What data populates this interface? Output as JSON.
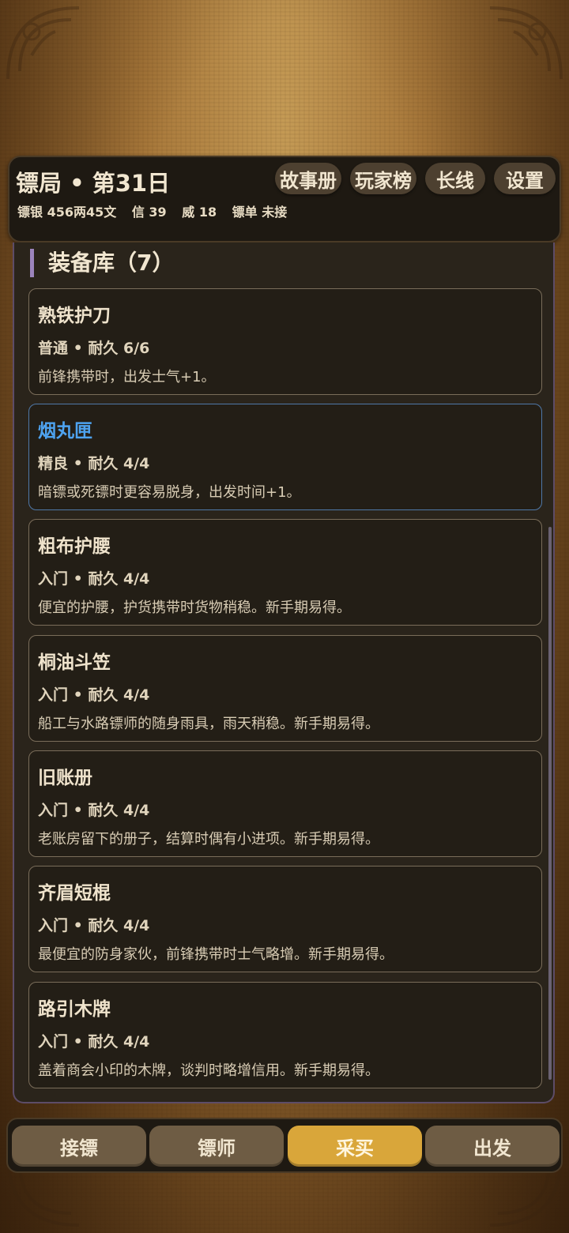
{
  "header": {
    "title": "镖局 • 第31日",
    "stats": {
      "silver": "镖银 456两45文",
      "trust": "信 39",
      "prestige": "威 18",
      "order": "镖单 未接"
    },
    "buttons": {
      "story": "故事册",
      "ranking": "玩家榜",
      "longline": "长线",
      "settings": "设置"
    }
  },
  "panel": {
    "title": "装备库（7）",
    "items": [
      {
        "name": "熟铁护刀",
        "meta": "普通 • 耐久 6/6",
        "desc": "前锋携带时，出发士气+1。"
      },
      {
        "name": "烟丸匣",
        "meta": "精良 • 耐久 4/4",
        "desc": "暗镖或死镖时更容易脱身，出发时间+1。"
      },
      {
        "name": "粗布护腰",
        "meta": "入门 • 耐久 4/4",
        "desc": "便宜的护腰，护货携带时货物稍稳。新手期易得。"
      },
      {
        "name": "桐油斗笠",
        "meta": "入门 • 耐久 4/4",
        "desc": "船工与水路镖师的随身雨具，雨天稍稳。新手期易得。"
      },
      {
        "name": "旧账册",
        "meta": "入门 • 耐久 4/4",
        "desc": "老账房留下的册子，结算时偶有小进项。新手期易得。"
      },
      {
        "name": "齐眉短棍",
        "meta": "入门 • 耐久 4/4",
        "desc": "最便宜的防身家伙，前锋携带时士气略增。新手期易得。"
      },
      {
        "name": "路引木牌",
        "meta": "入门 • 耐久 4/4",
        "desc": "盖着商会小印的木牌，谈判时略增信用。新手期易得。"
      }
    ],
    "selected_index": 1
  },
  "nav": {
    "tabs": [
      "接镖",
      "镖师",
      "采买",
      "出发"
    ],
    "active_index": 2
  },
  "colors": {
    "accent_gold": "#d9a63a",
    "selected_blue": "#4ea3f0",
    "section_bar_purple": "#9c84bc"
  }
}
